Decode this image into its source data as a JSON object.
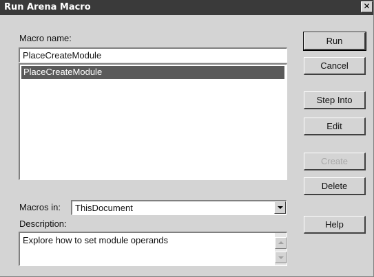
{
  "window": {
    "title": "Run Arena Macro",
    "close_glyph": "✕",
    "titlebar_color": "#3a3a3a",
    "background_color": "#d4d4d4"
  },
  "macro_name": {
    "label": "Macro name:",
    "value": "PlaceCreateModule"
  },
  "macro_list": {
    "items": [
      {
        "label": "PlaceCreateModule",
        "selected": true
      }
    ],
    "selection_color": "#5a5a5a"
  },
  "macros_in": {
    "label": "Macros in:",
    "selected": "ThisDocument"
  },
  "description": {
    "label": "Description:",
    "text": "Explore how to set module operands"
  },
  "buttons": {
    "run": "Run",
    "cancel": "Cancel",
    "step_into": "Step Into",
    "edit": "Edit",
    "create": "Create",
    "delete": "Delete",
    "help": "Help"
  },
  "icons": {
    "close": "close-icon",
    "dropdown": "chevron-down-icon",
    "scroll_up": "scroll-up-icon",
    "scroll_down": "scroll-down-icon"
  }
}
